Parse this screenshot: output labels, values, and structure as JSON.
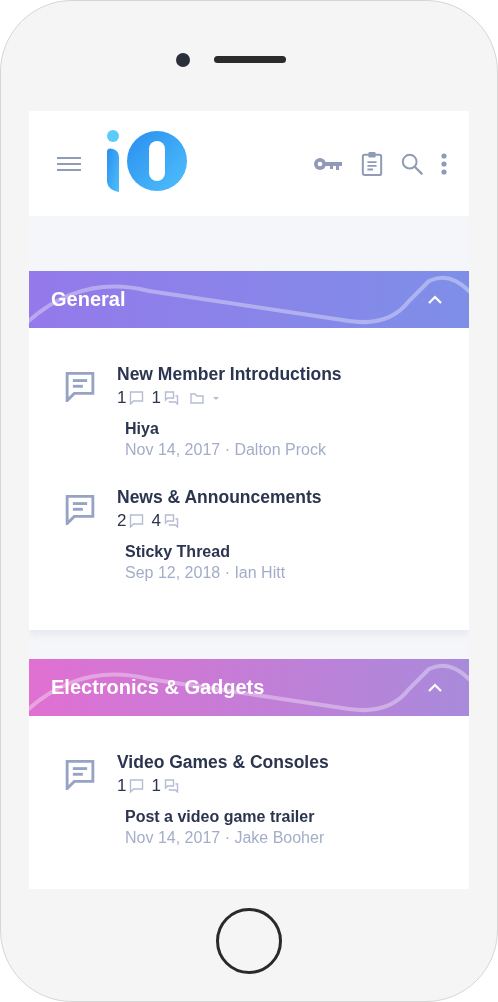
{
  "categories": [
    {
      "title": "General",
      "color": "#9479ea",
      "expanded": true,
      "forums": [
        {
          "title": "New Member Introductions",
          "threads": "1",
          "messages": "1",
          "has_subforums": true,
          "latest": {
            "title": "Hiya",
            "meta": "Nov 14, 2017 · Dalton Prock"
          }
        },
        {
          "title": "News & Announcements",
          "threads": "2",
          "messages": "4",
          "has_subforums": false,
          "latest": {
            "title": "Sticky Thread",
            "meta": "Sep 12, 2018 · Ian Hitt"
          }
        }
      ]
    },
    {
      "title": "Electronics & Gadgets",
      "color": "#e070d2",
      "expanded": true,
      "forums": [
        {
          "title": "Video Games & Consoles",
          "threads": "1",
          "messages": "1",
          "has_subforums": false,
          "latest": {
            "title": "Post a video game trailer",
            "meta": "Nov 14, 2017 · Jake Booher"
          }
        }
      ]
    }
  ]
}
